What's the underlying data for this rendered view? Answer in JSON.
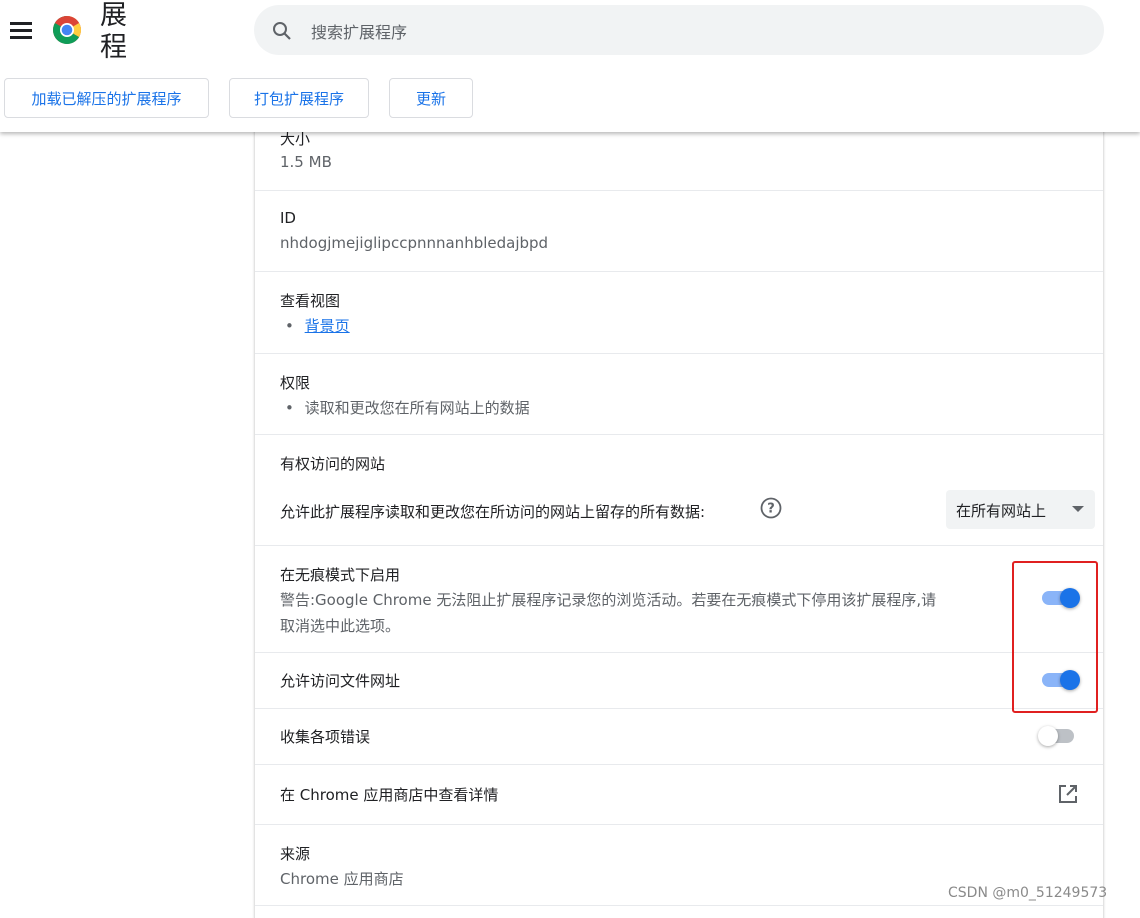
{
  "header": {
    "title": "展\n程",
    "search_placeholder": "搜索扩展程序",
    "buttons": {
      "load_unpacked": "加载已解压的扩展程序",
      "pack": "打包扩展程序",
      "update": "更新"
    }
  },
  "details": {
    "size": {
      "label": "大小",
      "value": "1.5 MB"
    },
    "id": {
      "label": "ID",
      "value": "nhdogjmejiglipccpnnnanhbledajbpd"
    },
    "inspect_views": {
      "label": "查看视图",
      "link": "背景页"
    },
    "permissions": {
      "label": "权限",
      "item": "读取和更改您在所有网站上的数据"
    },
    "site_access": {
      "label": "有权访问的网站",
      "description": "允许此扩展程序读取和更改您在所访问的网站上留存的所有数据:",
      "selected": "在所有网站上"
    },
    "incognito": {
      "label": "在无痕模式下启用",
      "warning_line1": "警告:Google Chrome 无法阻止扩展程序记录您的浏览活动。若要在无痕模式下停用该扩展程序,请",
      "warning_line2": "取消选中此选项。",
      "enabled": true
    },
    "file_urls": {
      "label": "允许访问文件网址",
      "enabled": true
    },
    "collect_errors": {
      "label": "收集各项错误",
      "enabled": false
    },
    "webstore": {
      "label": "在 Chrome 应用商店中查看详情"
    },
    "source": {
      "label": "来源",
      "value": "Chrome 应用商店"
    }
  },
  "watermark": "CSDN @m0_51249573",
  "colors": {
    "accent": "#1a73e8",
    "toggle_track_on": "#8ab4f8",
    "highlight_box": "#e02020"
  }
}
